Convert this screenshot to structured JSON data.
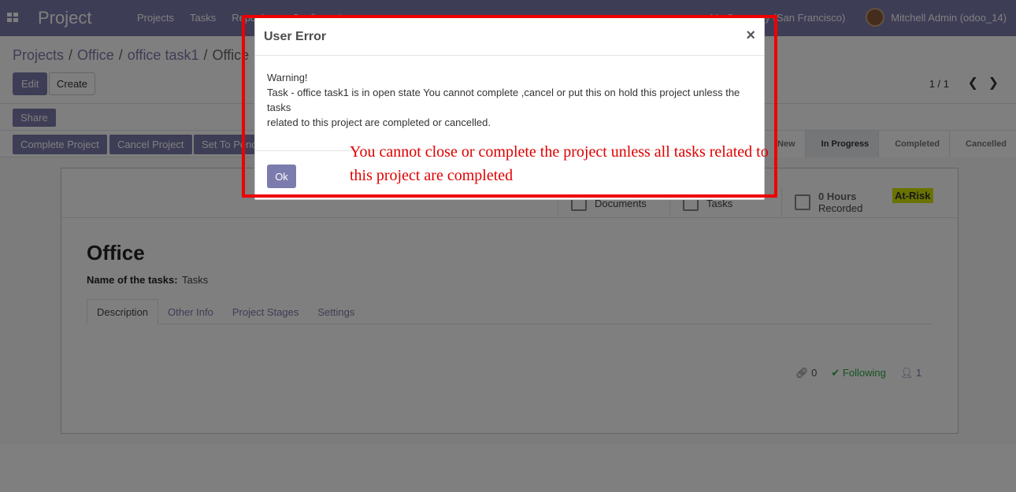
{
  "navbar": {
    "brand": "Project",
    "menu": [
      "Projects",
      "Tasks",
      "Reporting",
      "Configuration"
    ],
    "company": "My Company (San Francisco)",
    "user": "Mitchell Admin (odoo_14)"
  },
  "control_panel": {
    "breadcrumb": [
      "Projects",
      "Office",
      "office task1",
      "Office"
    ],
    "edit_label": "Edit",
    "create_label": "Create",
    "pager": "1 / 1",
    "prev_icon": "chevron-left-icon",
    "next_icon": "chevron-right-icon"
  },
  "share_label": "Share",
  "status_buttons": [
    "Complete Project",
    "Cancel Project",
    "Set To Pending"
  ],
  "stages": [
    "New",
    "In Progress",
    "Completed",
    "Cancelled"
  ],
  "current_stage": "In Progress",
  "sheet": {
    "stats": [
      {
        "value": "",
        "label": "Documents"
      },
      {
        "value": "",
        "label": "Tasks"
      },
      {
        "value": "0 Hours",
        "label": "Recorded"
      }
    ],
    "risk_badge": "At-Risk",
    "title": "Office",
    "field_label": "Name of the tasks:",
    "field_value": "Tasks",
    "tabs": [
      "Description",
      "Other Info",
      "Project Stages",
      "Settings"
    ],
    "chatter": {
      "attachments": "0",
      "following": "Following",
      "followers": "1"
    }
  },
  "modal": {
    "title": "User Error",
    "close_symbol": "×",
    "body_lines": [
      "Warning!",
      " Task - office task1 is in open state You cannot complete ,cancel or put this on hold this project unless the tasks",
      " related to this project are completed or cancelled."
    ],
    "ok_label": "Ok"
  },
  "annotation": {
    "text": "You cannot close or complete the project unless all tasks related to this project are completed",
    "color": "#ee0000"
  },
  "colors": {
    "accent": "#7c7bad",
    "risk": "#d4e600"
  }
}
